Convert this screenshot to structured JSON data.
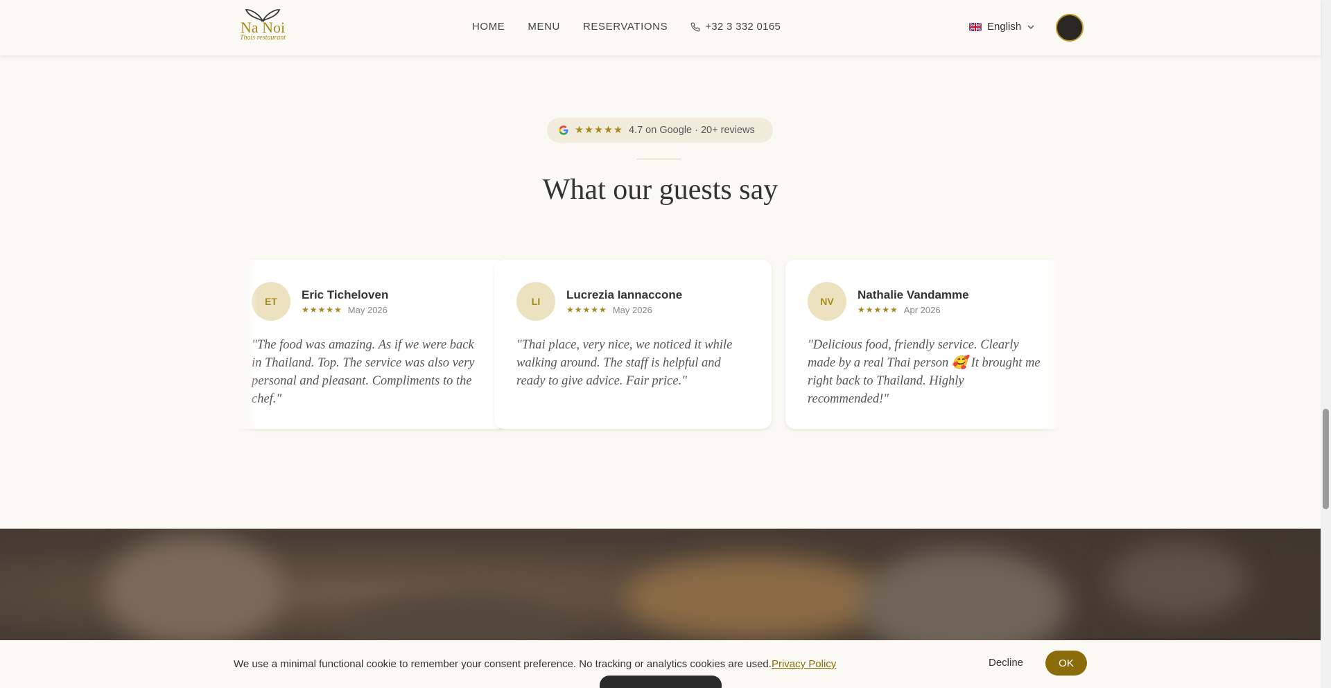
{
  "header": {
    "logo_name": "Na Noi",
    "logo_sub": "Thais restaurant",
    "nav": [
      "HOME",
      "MENU",
      "RESERVATIONS"
    ],
    "phone": "+32 3 332 0165",
    "language": "English"
  },
  "rating": {
    "stars": "★★★★★",
    "text": "4.7 on Google · 20+ reviews"
  },
  "section_title": "What our guests say",
  "reviews": [
    {
      "initials": "ET",
      "name": "Eric Ticheloven",
      "stars": "★★★★★",
      "date": "May 2026",
      "quote": "\"The food was amazing. As if we were back in Thailand. Top. The service was also very personal and pleasant. Compliments to the chef.\""
    },
    {
      "initials": "LI",
      "name": "Lucrezia Iannaccone",
      "stars": "★★★★★",
      "date": "May 2026",
      "quote": "\"Thai place, very nice, we noticed it while walking around. The staff is helpful and ready to give advice. Fair price.\""
    },
    {
      "initials": "NV",
      "name": "Nathalie Vandamme",
      "stars": "★★★★★",
      "date": "Apr 2026",
      "quote": "\"Delicious food, friendly service. Clearly made by a real Thai person 🥰 It brought me right back to Thailand. Highly recommended!\""
    }
  ],
  "cookie": {
    "text": "We use a minimal functional cookie to remember your consent preference. No tracking or analytics cookies are used.",
    "privacy_link": "Privacy Policy",
    "decline": "Decline",
    "ok": "OK"
  },
  "colors": {
    "accent": "#a8891f",
    "button": "#8a6d0a",
    "background": "#fbf9f4"
  }
}
